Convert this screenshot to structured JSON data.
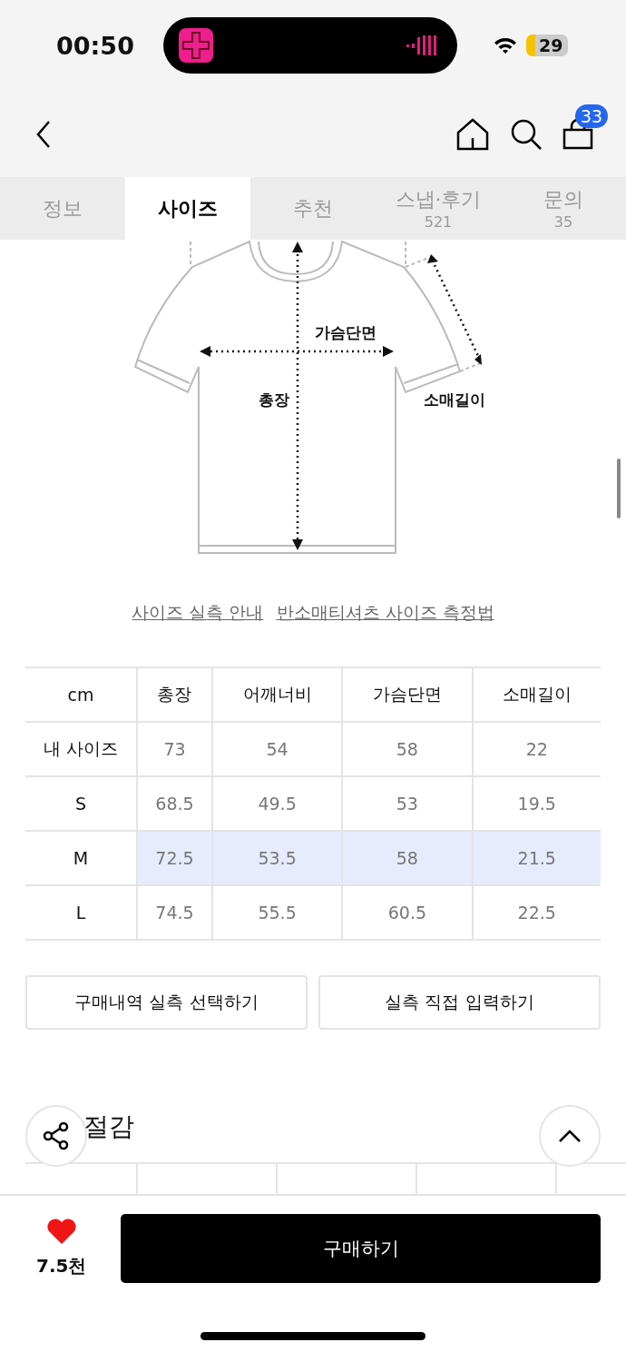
{
  "status_bar": {
    "time": "00:50",
    "battery": "29"
  },
  "nav": {
    "cart_count": "33"
  },
  "tabs": [
    {
      "label": "정보",
      "selected": false
    },
    {
      "label": "사이즈",
      "selected": true
    },
    {
      "label": "추천",
      "selected": false
    },
    {
      "label": "스냅·후기",
      "count": "521",
      "selected": false
    },
    {
      "label": "문의",
      "count": "35",
      "selected": false
    }
  ],
  "diagram": {
    "labels": [
      "가슴단면",
      "총장",
      "소매길이"
    ]
  },
  "links": [
    "사이즈 실측 안내",
    "반소매티셔츠 사이즈 측정법"
  ],
  "size_table": {
    "columns": [
      "cm",
      "총장",
      "어깨너비",
      "가슴단면",
      "소매길이"
    ],
    "rows": [
      {
        "size": "내 사이즈",
        "values": [
          "73",
          "54",
          "58",
          "22"
        ],
        "selected": false
      },
      {
        "size": "S",
        "values": [
          "68.5",
          "49.5",
          "53",
          "19.5"
        ],
        "selected": false
      },
      {
        "size": "M",
        "values": [
          "72.5",
          "53.5",
          "58",
          "21.5"
        ],
        "selected": true
      },
      {
        "size": "L",
        "values": [
          "74.5",
          "55.5",
          "60.5",
          "22.5"
        ],
        "selected": false
      }
    ]
  },
  "actions": [
    "구매내역 실측 선택하기",
    "실측 직접 입력하기"
  ],
  "section_heading": "절감",
  "bottom_bar": {
    "likes": "7.5천",
    "buy_button": "구매하기"
  }
}
